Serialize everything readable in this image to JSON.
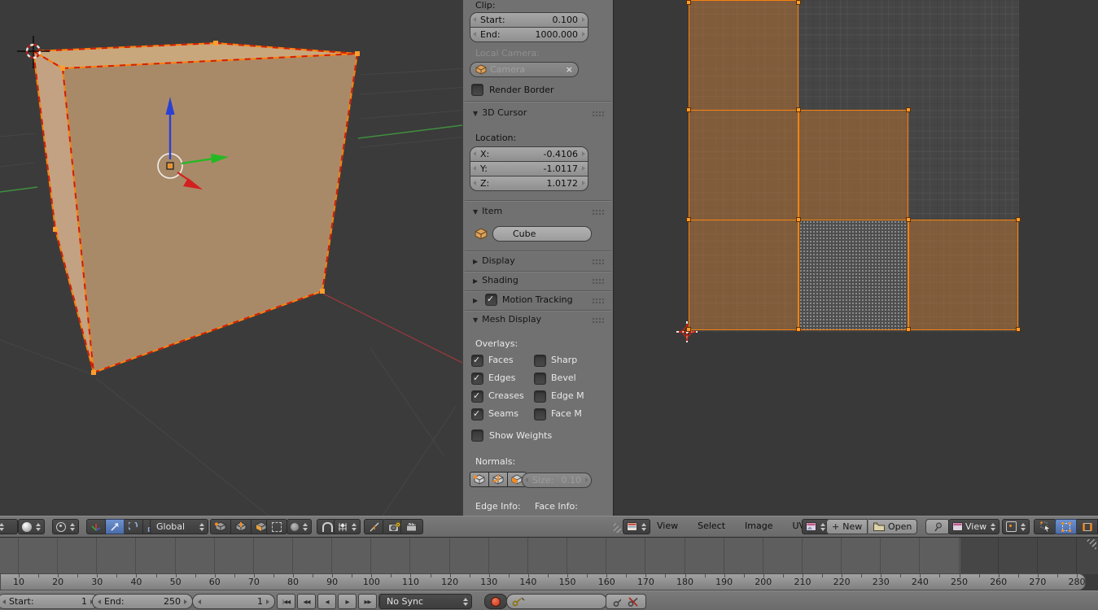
{
  "viewport3d": {
    "header": {
      "orientation_value": "Global"
    }
  },
  "properties_panel": {
    "clip": {
      "label": "Clip:",
      "start_label": "Start:",
      "start_value": "0.100",
      "end_label": "End:",
      "end_value": "1000.000"
    },
    "local_camera": {
      "label": "Local Camera:",
      "value": "Camera"
    },
    "render_border": {
      "label": "Render Border",
      "checked": false
    },
    "cursor3d": {
      "title": "3D Cursor",
      "location_label": "Location:",
      "x_label": "X:",
      "x_value": "-0.4106",
      "y_label": "Y:",
      "y_value": "-1.0117",
      "z_label": "Z:",
      "z_value": "1.0172"
    },
    "item": {
      "title": "Item",
      "name_value": "Cube"
    },
    "display": {
      "title": "Display"
    },
    "shading": {
      "title": "Shading"
    },
    "motion_tracking": {
      "title": "Motion Tracking",
      "checked": true
    },
    "mesh_display": {
      "title": "Mesh Display",
      "overlays_label": "Overlays:",
      "checkboxes": [
        {
          "label": "Faces",
          "checked": true
        },
        {
          "label": "Sharp",
          "checked": false
        },
        {
          "label": "Edges",
          "checked": true
        },
        {
          "label": "Bevel",
          "checked": false
        },
        {
          "label": "Creases",
          "checked": true
        },
        {
          "label": "Edge M",
          "checked": false
        },
        {
          "label": "Seams",
          "checked": true
        },
        {
          "label": "Face M",
          "checked": false
        }
      ],
      "show_weights": {
        "label": "Show Weights",
        "checked": false
      },
      "normals_label": "Normals:",
      "size_label": "Size:",
      "size_value": "0.10",
      "edge_info_label": "Edge Info:",
      "face_info_label": "Face Info:"
    }
  },
  "uv_editor": {
    "menus": [
      "View",
      "Select",
      "Image",
      "UVs"
    ],
    "new_label": "New",
    "open_label": "Open",
    "view_dropdown_value": "View",
    "uv_faces": [
      {
        "col": 0,
        "row": 0,
        "state": "selected"
      },
      {
        "col": 0,
        "row": 1,
        "state": "selected"
      },
      {
        "col": 1,
        "row": 1,
        "state": "selected"
      },
      {
        "col": 0,
        "row": 2,
        "state": "selected"
      },
      {
        "col": 1,
        "row": 2,
        "state": "active"
      },
      {
        "col": 2,
        "row": 2,
        "state": "selected"
      }
    ]
  },
  "timeline": {
    "start_label": "Start:",
    "start_value": "1",
    "end_label": "End:",
    "end_value": "250",
    "frame_value": "1",
    "sync_value": "No Sync",
    "ruler": [
      10,
      20,
      30,
      40,
      50,
      60,
      70,
      80,
      90,
      100,
      110,
      120,
      130,
      140,
      150,
      160,
      170,
      180,
      190,
      200,
      210,
      220,
      230,
      240,
      250,
      260,
      270,
      280
    ],
    "playback": [
      {
        "name": "jump-to-start-button",
        "glyph": "|◀◀"
      },
      {
        "name": "prev-keyframe-button",
        "glyph": "◀◀"
      },
      {
        "name": "play-reverse-button",
        "glyph": "◀"
      },
      {
        "name": "play-button",
        "glyph": "▶"
      },
      {
        "name": "next-keyframe-button",
        "glyph": "▶▶"
      },
      {
        "name": "jump-to-end-button",
        "glyph": "▶▶|"
      }
    ]
  },
  "colors": {
    "selection_orange": "#f9820e",
    "seam_red": "#d21e04",
    "active_tool_blue": "#5b82c2",
    "uv_face_fill": "rgba(187,116,50,0.5)",
    "cube_front": "#a98a68",
    "cube_top": "#c9a77d",
    "cube_side": "#c2a283",
    "axis_x_red": "#96393c",
    "axis_y_green": "#3f8f3f",
    "gizmo_blue": "#2b3fd4",
    "gizmo_green": "#25b825",
    "gizmo_red": "#d41f1f"
  }
}
